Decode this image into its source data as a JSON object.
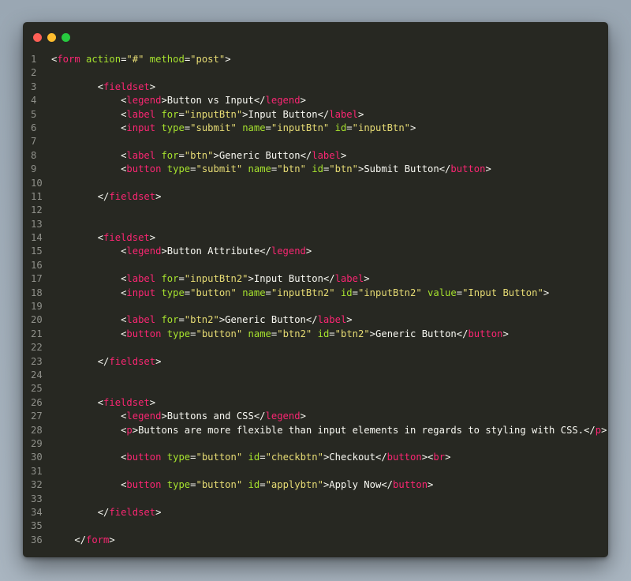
{
  "window": {
    "traffic_lights": [
      {
        "name": "close",
        "color": "#ff5f56"
      },
      {
        "name": "minimize",
        "color": "#ffbd2e"
      },
      {
        "name": "maximize",
        "color": "#27c93f"
      }
    ]
  },
  "theme": {
    "background": "#272822",
    "tag": "#f92672",
    "attribute": "#a6e22e",
    "string": "#e6db74",
    "text": "#f8f8f2",
    "line_number": "#8f908a"
  },
  "code_lines": [
    {
      "n": "1",
      "indent": 0,
      "tokens": [
        [
          "pun",
          "<"
        ],
        [
          "tag",
          "form"
        ],
        [
          "txt",
          " "
        ],
        [
          "attr",
          "action"
        ],
        [
          "pun",
          "="
        ],
        [
          "val",
          "\"#\""
        ],
        [
          "txt",
          " "
        ],
        [
          "attr",
          "method"
        ],
        [
          "pun",
          "="
        ],
        [
          "val",
          "\"post\""
        ],
        [
          "pun",
          ">"
        ]
      ]
    },
    {
      "n": "2",
      "indent": 0,
      "tokens": []
    },
    {
      "n": "3",
      "indent": 8,
      "tokens": [
        [
          "pun",
          "<"
        ],
        [
          "tag",
          "fieldset"
        ],
        [
          "pun",
          ">"
        ]
      ]
    },
    {
      "n": "4",
      "indent": 12,
      "tokens": [
        [
          "pun",
          "<"
        ],
        [
          "tag",
          "legend"
        ],
        [
          "pun",
          ">"
        ],
        [
          "txt",
          "Button vs Input"
        ],
        [
          "pun",
          "</"
        ],
        [
          "tag",
          "legend"
        ],
        [
          "pun",
          ">"
        ]
      ]
    },
    {
      "n": "5",
      "indent": 12,
      "tokens": [
        [
          "pun",
          "<"
        ],
        [
          "tag",
          "label"
        ],
        [
          "txt",
          " "
        ],
        [
          "attr",
          "for"
        ],
        [
          "pun",
          "="
        ],
        [
          "val",
          "\"inputBtn\""
        ],
        [
          "pun",
          ">"
        ],
        [
          "txt",
          "Input Button"
        ],
        [
          "pun",
          "</"
        ],
        [
          "tag",
          "label"
        ],
        [
          "pun",
          ">"
        ]
      ]
    },
    {
      "n": "6",
      "indent": 12,
      "tokens": [
        [
          "pun",
          "<"
        ],
        [
          "tag",
          "input"
        ],
        [
          "txt",
          " "
        ],
        [
          "attr",
          "type"
        ],
        [
          "pun",
          "="
        ],
        [
          "val",
          "\"submit\""
        ],
        [
          "txt",
          " "
        ],
        [
          "attr",
          "name"
        ],
        [
          "pun",
          "="
        ],
        [
          "val",
          "\"inputBtn\""
        ],
        [
          "txt",
          " "
        ],
        [
          "attr",
          "id"
        ],
        [
          "pun",
          "="
        ],
        [
          "val",
          "\"inputBtn\""
        ],
        [
          "pun",
          ">"
        ]
      ]
    },
    {
      "n": "7",
      "indent": 0,
      "tokens": []
    },
    {
      "n": "8",
      "indent": 12,
      "tokens": [
        [
          "pun",
          "<"
        ],
        [
          "tag",
          "label"
        ],
        [
          "txt",
          " "
        ],
        [
          "attr",
          "for"
        ],
        [
          "pun",
          "="
        ],
        [
          "val",
          "\"btn\""
        ],
        [
          "pun",
          ">"
        ],
        [
          "txt",
          "Generic Button"
        ],
        [
          "pun",
          "</"
        ],
        [
          "tag",
          "label"
        ],
        [
          "pun",
          ">"
        ]
      ]
    },
    {
      "n": "9",
      "indent": 12,
      "tokens": [
        [
          "pun",
          "<"
        ],
        [
          "tag",
          "button"
        ],
        [
          "txt",
          " "
        ],
        [
          "attr",
          "type"
        ],
        [
          "pun",
          "="
        ],
        [
          "val",
          "\"submit\""
        ],
        [
          "txt",
          " "
        ],
        [
          "attr",
          "name"
        ],
        [
          "pun",
          "="
        ],
        [
          "val",
          "\"btn\""
        ],
        [
          "txt",
          " "
        ],
        [
          "attr",
          "id"
        ],
        [
          "pun",
          "="
        ],
        [
          "val",
          "\"btn\""
        ],
        [
          "pun",
          ">"
        ],
        [
          "txt",
          "Submit Button"
        ],
        [
          "pun",
          "</"
        ],
        [
          "tag",
          "button"
        ],
        [
          "pun",
          ">"
        ]
      ]
    },
    {
      "n": "10",
      "indent": 0,
      "tokens": []
    },
    {
      "n": "11",
      "indent": 8,
      "tokens": [
        [
          "pun",
          "</"
        ],
        [
          "tag",
          "fieldset"
        ],
        [
          "pun",
          ">"
        ]
      ]
    },
    {
      "n": "12",
      "indent": 0,
      "tokens": []
    },
    {
      "n": "13",
      "indent": 0,
      "tokens": []
    },
    {
      "n": "14",
      "indent": 8,
      "tokens": [
        [
          "pun",
          "<"
        ],
        [
          "tag",
          "fieldset"
        ],
        [
          "pun",
          ">"
        ]
      ]
    },
    {
      "n": "15",
      "indent": 12,
      "tokens": [
        [
          "pun",
          "<"
        ],
        [
          "tag",
          "legend"
        ],
        [
          "pun",
          ">"
        ],
        [
          "txt",
          "Button Attribute"
        ],
        [
          "pun",
          "</"
        ],
        [
          "tag",
          "legend"
        ],
        [
          "pun",
          ">"
        ]
      ]
    },
    {
      "n": "16",
      "indent": 0,
      "tokens": []
    },
    {
      "n": "17",
      "indent": 12,
      "tokens": [
        [
          "pun",
          "<"
        ],
        [
          "tag",
          "label"
        ],
        [
          "txt",
          " "
        ],
        [
          "attr",
          "for"
        ],
        [
          "pun",
          "="
        ],
        [
          "val",
          "\"inputBtn2\""
        ],
        [
          "pun",
          ">"
        ],
        [
          "txt",
          "Input Button"
        ],
        [
          "pun",
          "</"
        ],
        [
          "tag",
          "label"
        ],
        [
          "pun",
          ">"
        ]
      ]
    },
    {
      "n": "18",
      "indent": 12,
      "tokens": [
        [
          "pun",
          "<"
        ],
        [
          "tag",
          "input"
        ],
        [
          "txt",
          " "
        ],
        [
          "attr",
          "type"
        ],
        [
          "pun",
          "="
        ],
        [
          "val",
          "\"button\""
        ],
        [
          "txt",
          " "
        ],
        [
          "attr",
          "name"
        ],
        [
          "pun",
          "="
        ],
        [
          "val",
          "\"inputBtn2\""
        ],
        [
          "txt",
          " "
        ],
        [
          "attr",
          "id"
        ],
        [
          "pun",
          "="
        ],
        [
          "val",
          "\"inputBtn2\""
        ],
        [
          "txt",
          " "
        ],
        [
          "attr",
          "value"
        ],
        [
          "pun",
          "="
        ],
        [
          "val",
          "\"Input Button\""
        ],
        [
          "pun",
          ">"
        ]
      ]
    },
    {
      "n": "19",
      "indent": 0,
      "tokens": []
    },
    {
      "n": "20",
      "indent": 12,
      "tokens": [
        [
          "pun",
          "<"
        ],
        [
          "tag",
          "label"
        ],
        [
          "txt",
          " "
        ],
        [
          "attr",
          "for"
        ],
        [
          "pun",
          "="
        ],
        [
          "val",
          "\"btn2\""
        ],
        [
          "pun",
          ">"
        ],
        [
          "txt",
          "Generic Button"
        ],
        [
          "pun",
          "</"
        ],
        [
          "tag",
          "label"
        ],
        [
          "pun",
          ">"
        ]
      ]
    },
    {
      "n": "21",
      "indent": 12,
      "tokens": [
        [
          "pun",
          "<"
        ],
        [
          "tag",
          "button"
        ],
        [
          "txt",
          " "
        ],
        [
          "attr",
          "type"
        ],
        [
          "pun",
          "="
        ],
        [
          "val",
          "\"button\""
        ],
        [
          "txt",
          " "
        ],
        [
          "attr",
          "name"
        ],
        [
          "pun",
          "="
        ],
        [
          "val",
          "\"btn2\""
        ],
        [
          "txt",
          " "
        ],
        [
          "attr",
          "id"
        ],
        [
          "pun",
          "="
        ],
        [
          "val",
          "\"btn2\""
        ],
        [
          "pun",
          ">"
        ],
        [
          "txt",
          "Generic Button"
        ],
        [
          "pun",
          "</"
        ],
        [
          "tag",
          "button"
        ],
        [
          "pun",
          ">"
        ]
      ]
    },
    {
      "n": "22",
      "indent": 0,
      "tokens": []
    },
    {
      "n": "23",
      "indent": 8,
      "tokens": [
        [
          "pun",
          "</"
        ],
        [
          "tag",
          "fieldset"
        ],
        [
          "pun",
          ">"
        ]
      ]
    },
    {
      "n": "24",
      "indent": 0,
      "tokens": []
    },
    {
      "n": "25",
      "indent": 0,
      "tokens": []
    },
    {
      "n": "26",
      "indent": 8,
      "tokens": [
        [
          "pun",
          "<"
        ],
        [
          "tag",
          "fieldset"
        ],
        [
          "pun",
          ">"
        ]
      ]
    },
    {
      "n": "27",
      "indent": 12,
      "tokens": [
        [
          "pun",
          "<"
        ],
        [
          "tag",
          "legend"
        ],
        [
          "pun",
          ">"
        ],
        [
          "txt",
          "Buttons and CSS"
        ],
        [
          "pun",
          "</"
        ],
        [
          "tag",
          "legend"
        ],
        [
          "pun",
          ">"
        ]
      ]
    },
    {
      "n": "28",
      "indent": 12,
      "tokens": [
        [
          "pun",
          "<"
        ],
        [
          "tag",
          "p"
        ],
        [
          "pun",
          ">"
        ],
        [
          "txt",
          "Buttons are more flexible than input elements in regards to styling with CSS."
        ],
        [
          "pun",
          "</"
        ],
        [
          "tag",
          "p"
        ],
        [
          "pun",
          ">"
        ]
      ]
    },
    {
      "n": "29",
      "indent": 0,
      "tokens": []
    },
    {
      "n": "30",
      "indent": 12,
      "tokens": [
        [
          "pun",
          "<"
        ],
        [
          "tag",
          "button"
        ],
        [
          "txt",
          " "
        ],
        [
          "attr",
          "type"
        ],
        [
          "pun",
          "="
        ],
        [
          "val",
          "\"button\""
        ],
        [
          "txt",
          " "
        ],
        [
          "attr",
          "id"
        ],
        [
          "pun",
          "="
        ],
        [
          "val",
          "\"checkbtn\""
        ],
        [
          "pun",
          ">"
        ],
        [
          "txt",
          "Checkout"
        ],
        [
          "pun",
          "</"
        ],
        [
          "tag",
          "button"
        ],
        [
          "pun",
          "><"
        ],
        [
          "tag",
          "br"
        ],
        [
          "pun",
          ">"
        ]
      ]
    },
    {
      "n": "31",
      "indent": 0,
      "tokens": []
    },
    {
      "n": "32",
      "indent": 12,
      "tokens": [
        [
          "pun",
          "<"
        ],
        [
          "tag",
          "button"
        ],
        [
          "txt",
          " "
        ],
        [
          "attr",
          "type"
        ],
        [
          "pun",
          "="
        ],
        [
          "val",
          "\"button\""
        ],
        [
          "txt",
          " "
        ],
        [
          "attr",
          "id"
        ],
        [
          "pun",
          "="
        ],
        [
          "val",
          "\"applybtn\""
        ],
        [
          "pun",
          ">"
        ],
        [
          "txt",
          "Apply Now"
        ],
        [
          "pun",
          "</"
        ],
        [
          "tag",
          "button"
        ],
        [
          "pun",
          ">"
        ]
      ]
    },
    {
      "n": "33",
      "indent": 0,
      "tokens": []
    },
    {
      "n": "34",
      "indent": 8,
      "tokens": [
        [
          "pun",
          "</"
        ],
        [
          "tag",
          "fieldset"
        ],
        [
          "pun",
          ">"
        ]
      ]
    },
    {
      "n": "35",
      "indent": 0,
      "tokens": []
    },
    {
      "n": "36",
      "indent": 4,
      "tokens": [
        [
          "pun",
          "</"
        ],
        [
          "tag",
          "form"
        ],
        [
          "pun",
          ">"
        ]
      ]
    }
  ]
}
